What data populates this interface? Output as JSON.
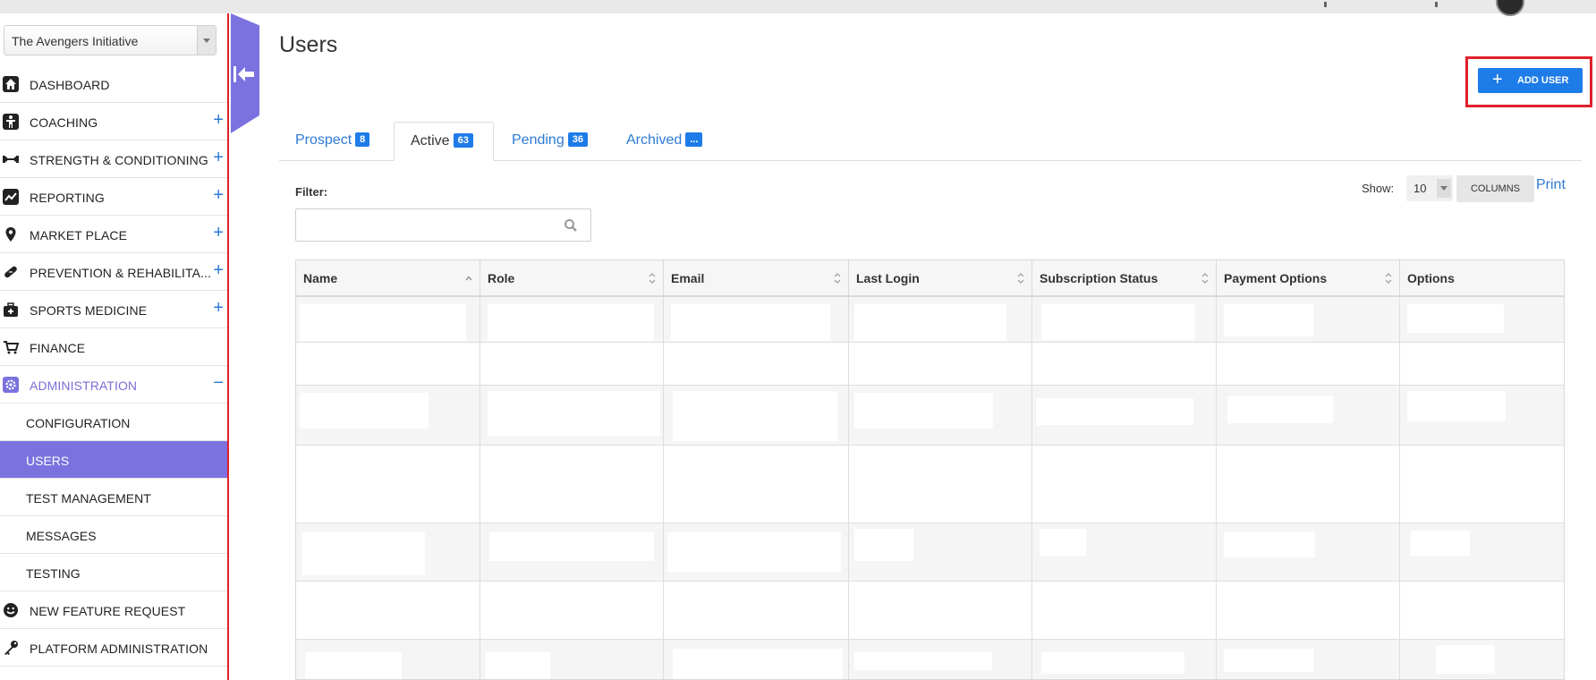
{
  "org_selector": {
    "value": "The Avengers Initiative"
  },
  "sidebar": {
    "items": [
      {
        "label": "DASHBOARD",
        "icon": "home-icon",
        "expandable": false
      },
      {
        "label": "COACHING",
        "icon": "coach-icon",
        "expandable": true,
        "toggle": "+"
      },
      {
        "label": "STRENGTH & CONDITIONING",
        "icon": "dumbbell-icon",
        "expandable": true,
        "toggle": "+"
      },
      {
        "label": "REPORTING",
        "icon": "chart-line-icon",
        "expandable": true,
        "toggle": "+"
      },
      {
        "label": "MARKET PLACE",
        "icon": "map-pin-icon",
        "expandable": true,
        "toggle": "+"
      },
      {
        "label": "PREVENTION & REHABILITA...",
        "icon": "bandage-icon",
        "expandable": true,
        "toggle": "+"
      },
      {
        "label": "SPORTS MEDICINE",
        "icon": "medkit-icon",
        "expandable": true,
        "toggle": "+"
      },
      {
        "label": "FINANCE",
        "icon": "cart-icon",
        "expandable": false
      },
      {
        "label": "ADMINISTRATION",
        "icon": "gear-icon",
        "expandable": true,
        "toggle": "−"
      }
    ],
    "admin_children": [
      {
        "label": "CONFIGURATION"
      },
      {
        "label": "USERS"
      },
      {
        "label": "TEST MANAGEMENT"
      },
      {
        "label": "MESSAGES"
      },
      {
        "label": "TESTING"
      }
    ],
    "bottom_items": [
      {
        "label": "NEW FEATURE REQUEST",
        "icon": "smiley-icon"
      },
      {
        "label": "PLATFORM ADMINISTRATION",
        "icon": "key-icon"
      }
    ]
  },
  "page": {
    "title": "Users",
    "add_user_label": "ADD USER",
    "add_user_icon": "+"
  },
  "tabs": [
    {
      "label": "Prospect",
      "count": "8"
    },
    {
      "label": "Active",
      "count": "63"
    },
    {
      "label": "Pending",
      "count": "36"
    },
    {
      "label": "Archived",
      "count": "..."
    }
  ],
  "filter": {
    "label": "Filter:",
    "value": ""
  },
  "toolbar": {
    "show_label": "Show:",
    "page_size": "10",
    "columns_label": "COLUMNS",
    "print_label": "Print"
  },
  "table": {
    "columns": [
      "Name",
      "Role",
      "Email",
      "Last Login",
      "Subscription Status",
      "Payment Options",
      "Options"
    ]
  },
  "colors": {
    "accent": "#7b72df",
    "primary": "#1e7ce8",
    "link": "#2d7ad6",
    "highlight": "#e0202a"
  }
}
